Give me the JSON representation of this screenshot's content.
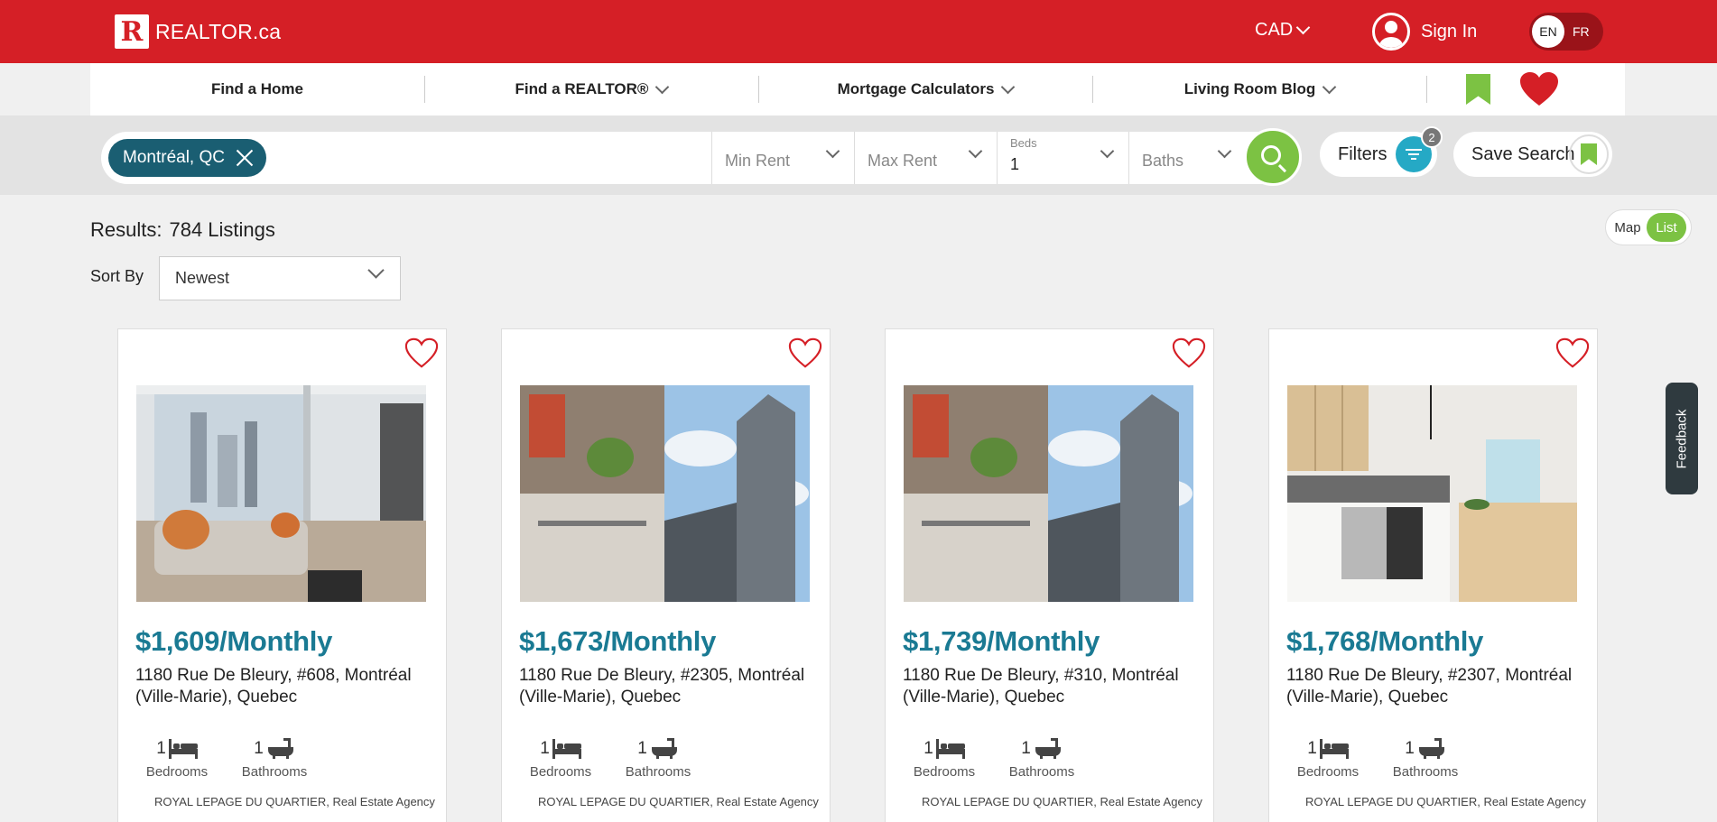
{
  "header": {
    "logo_mark": "R",
    "logo_text": "REALTOR.ca",
    "currency": "CAD",
    "sign_in": "Sign In",
    "lang_active": "EN",
    "lang_other": "FR",
    "brand_color": "#d51f26"
  },
  "nav": {
    "items": [
      {
        "label": "Find a Home"
      },
      {
        "label": "Find a REALTOR®"
      },
      {
        "label": "Mortgage Calculators"
      },
      {
        "label": "Living Room Blog"
      }
    ]
  },
  "search": {
    "location": "Montréal, QC",
    "min_rent": "Min Rent",
    "max_rent": "Max Rent",
    "beds_label": "Beds",
    "beds_value": "1",
    "baths": "Baths",
    "filters": "Filters",
    "filters_count": "2",
    "save_search": "Save Search"
  },
  "results": {
    "label": "Results:",
    "count": "784 Listings",
    "sort_label": "Sort By",
    "sort_value": "Newest",
    "view_map": "Map",
    "view_list": "List"
  },
  "feedback": "Feedback",
  "listings": [
    {
      "price": "$1,609/Monthly",
      "address": "1180 Rue De Bleury, #608, Montréal (Ville-Marie), Quebec",
      "beds": "1",
      "baths": "1",
      "beds_label": "Bedrooms",
      "baths_label": "Bathrooms",
      "agency": "ROYAL LEPAGE DU QUARTIER",
      "agency_type": ", Real Estate Agency"
    },
    {
      "price": "$1,673/Monthly",
      "address": "1180 Rue De Bleury, #2305, Montréal (Ville-Marie), Quebec",
      "beds": "1",
      "baths": "1",
      "beds_label": "Bedrooms",
      "baths_label": "Bathrooms",
      "agency": "ROYAL LEPAGE DU QUARTIER",
      "agency_type": ", Real Estate Agency"
    },
    {
      "price": "$1,739/Monthly",
      "address": "1180 Rue De Bleury, #310, Montréal (Ville-Marie), Quebec",
      "beds": "1",
      "baths": "1",
      "beds_label": "Bedrooms",
      "baths_label": "Bathrooms",
      "agency": "ROYAL LEPAGE DU QUARTIER",
      "agency_type": ", Real Estate Agency"
    },
    {
      "price": "$1,768/Monthly",
      "address": "1180 Rue De Bleury, #2307, Montréal (Ville-Marie), Quebec",
      "beds": "1",
      "baths": "1",
      "beds_label": "Bedrooms",
      "baths_label": "Bathrooms",
      "agency": "ROYAL LEPAGE DU QUARTIER",
      "agency_type": ", Real Estate Agency"
    }
  ],
  "colors": {
    "accent_teal": "#1a7a93",
    "chip_teal": "#1a5e72",
    "green": "#7cc243",
    "filter_blue": "#25a9c5"
  }
}
